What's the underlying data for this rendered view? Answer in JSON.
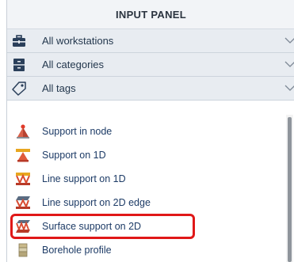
{
  "panel": {
    "title": "INPUT PANEL"
  },
  "filters": [
    {
      "label": "All workstations",
      "icon": "toolbox-icon"
    },
    {
      "label": "All categories",
      "icon": "cabinet-icon"
    },
    {
      "label": "All tags",
      "icon": "tag-icon"
    }
  ],
  "items": [
    {
      "label": "Support in node",
      "icon": "node-support-icon"
    },
    {
      "label": "Support on 1D",
      "icon": "support-1d-icon"
    },
    {
      "label": "Line support on 1D",
      "icon": "line-support-1d-icon"
    },
    {
      "label": "Line support on 2D edge",
      "icon": "line-support-2d-edge-icon"
    },
    {
      "label": "Surface support on 2D",
      "icon": "surface-support-2d-icon",
      "highlighted": true
    },
    {
      "label": "Borehole profile",
      "icon": "borehole-profile-icon"
    }
  ],
  "colors": {
    "highlight": "#e01818",
    "item_text": "#1d3b66",
    "filter_bg": "#e8ecf1"
  }
}
